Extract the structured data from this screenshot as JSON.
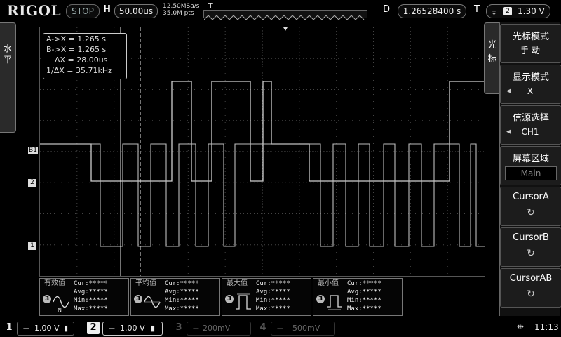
{
  "header": {
    "brand": "RIGOL",
    "run_state": "STOP",
    "horizontal_label": "H",
    "timebase": "50.00us",
    "sample_rate": "12.50MSa/s",
    "memory_depth": "35.0M pts",
    "trigger_pos_marker": "T",
    "delay_label": "D",
    "delay_value": "1.26528400 s",
    "trigger_label": "T",
    "trigger_slope_icon": "falling-edge-icon",
    "trigger_source": "2",
    "trigger_level": "1.30 V"
  },
  "left_panel": {
    "label": "水平"
  },
  "right_panel": {
    "label": "光标"
  },
  "cursor_readout": {
    "a_x": "A->X = 1.265 s",
    "b_x": "B->X = 1.265 s",
    "delta_x": "ΔX = 28.00us",
    "inv_delta_x": "1/ΔX = 35.71kHz"
  },
  "channel_markers": {
    "b1": "B1",
    "ch2": "2",
    "ch1": "1"
  },
  "menu": {
    "items": [
      {
        "title": "光标模式",
        "value": "手  动"
      },
      {
        "title": "显示模式",
        "value": "X"
      },
      {
        "title": "信源选择",
        "value": "CH1"
      },
      {
        "title": "屏幕区域",
        "value": "Main"
      },
      {
        "title": "CursorA",
        "value": "↻"
      },
      {
        "title": "CursorB",
        "value": "↻"
      },
      {
        "title": "CursorAB",
        "value": "↻"
      }
    ]
  },
  "measurements": [
    {
      "name": "有效值",
      "channel": "3",
      "cur": "Cur:*****",
      "avg": "Avg:*****",
      "min": "Min:*****",
      "max": "Max:*****"
    },
    {
      "name": "平均值",
      "channel": "3",
      "cur": "Cur:*****",
      "avg": "Avg:*****",
      "min": "Min:*****",
      "max": "Max:*****"
    },
    {
      "name": "最大值",
      "channel": "3",
      "cur": "Cur:*****",
      "avg": "Avg:*****",
      "min": "Min:*****",
      "max": "Max:*****"
    },
    {
      "name": "最小值",
      "channel": "3",
      "cur": "Cur:*****",
      "avg": "Avg:*****",
      "min": "Min:*****",
      "max": "Max:*****"
    }
  ],
  "channels": [
    {
      "num": "1",
      "scale": "1.00 V",
      "color": "#f0f0f0"
    },
    {
      "num": "2",
      "scale": "1.00 V",
      "color": "#f0f0f0"
    },
    {
      "num": "3",
      "scale": "200mV",
      "color": "#555555"
    },
    {
      "num": "4",
      "scale": "500mV",
      "color": "#555555"
    }
  ],
  "status": {
    "usb_icon": "usb-icon",
    "time": "11:13"
  }
}
